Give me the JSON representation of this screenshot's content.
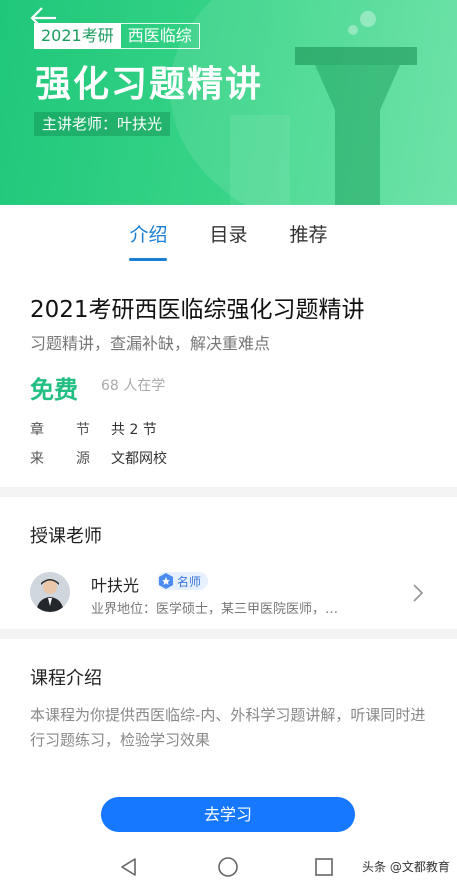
{
  "banner": {
    "tag_year": "2021考研",
    "tag_subject": "西医临综",
    "title": "强化习题精讲",
    "teacher_line": "主讲老师：叶扶光"
  },
  "tabs": [
    {
      "label": "介绍",
      "active": true
    },
    {
      "label": "目录",
      "active": false
    },
    {
      "label": "推荐",
      "active": false
    }
  ],
  "course": {
    "title": "2021考研西医临综强化习题精讲",
    "subtitle": "习题精讲，查漏补缺，解决重难点",
    "price": "免费",
    "learners": "68 人在学",
    "meta": [
      {
        "key_a": "章",
        "key_b": "节",
        "value": "共 2 节"
      },
      {
        "key_a": "来",
        "key_b": "源",
        "value": "文都网校"
      }
    ]
  },
  "teacher_section": {
    "heading": "授课老师",
    "name": "叶扶光",
    "badge": "名师",
    "description": "业界地位：医学硕士，某三甲医院医师，…"
  },
  "intro_section": {
    "heading": "课程介绍",
    "body": "本课程为你提供西医临综-内、外科学习题讲解，听课同时进行习题练习，检验学习效果"
  },
  "cta": {
    "label": "去学习"
  },
  "watermark": "头条 @文都教育",
  "colors": {
    "banner_green": "#2ccf80",
    "accent_blue": "#1a7fd4",
    "price_green": "#22bf83",
    "cta_blue": "#1677ff"
  },
  "icons": {
    "back": "arrow-left-icon",
    "badge": "star-badge-icon",
    "chevron": "chevron-right-icon",
    "nav_back": "triangle-back-icon",
    "nav_home": "circle-home-icon",
    "nav_recent": "square-recent-icon"
  }
}
